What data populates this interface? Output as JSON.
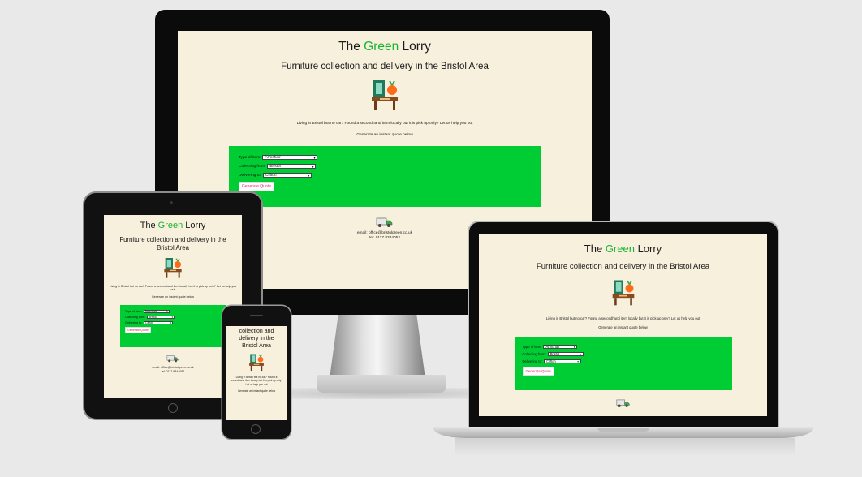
{
  "site": {
    "title_pre": "The ",
    "title_green": "Green",
    "title_post": " Lorry",
    "subtitle": "Furniture collection and delivery in the Bristol Area",
    "intro": "Living in Bristol but no car? Found a secondhand item locally but it is pick up only? Let us help you out",
    "cta": "Generate an instant quote below",
    "form": {
      "type_label": "Type of item:",
      "type_value": "Armchair",
      "from_label": "Collecting from:",
      "from_value": "Bristol",
      "to_label": "Delivering to:",
      "to_value": "Clifton",
      "button": "Generate Quote"
    },
    "footer": {
      "email": "email: office@bristolgreen.co.uk",
      "tel": "tel: 0117 8344052"
    }
  },
  "phone_text": {
    "heading": "collection and delivery in the Bristol Area"
  },
  "colors": {
    "page_bg": "#e9e9e9",
    "site_bg": "#f7f0dc",
    "form_bg": "#00cc33",
    "brand_green": "#19b432",
    "button_text": "#e0266b"
  },
  "icons": [
    "furniture-icon",
    "lorry-icon",
    "chevron-down-icon"
  ]
}
